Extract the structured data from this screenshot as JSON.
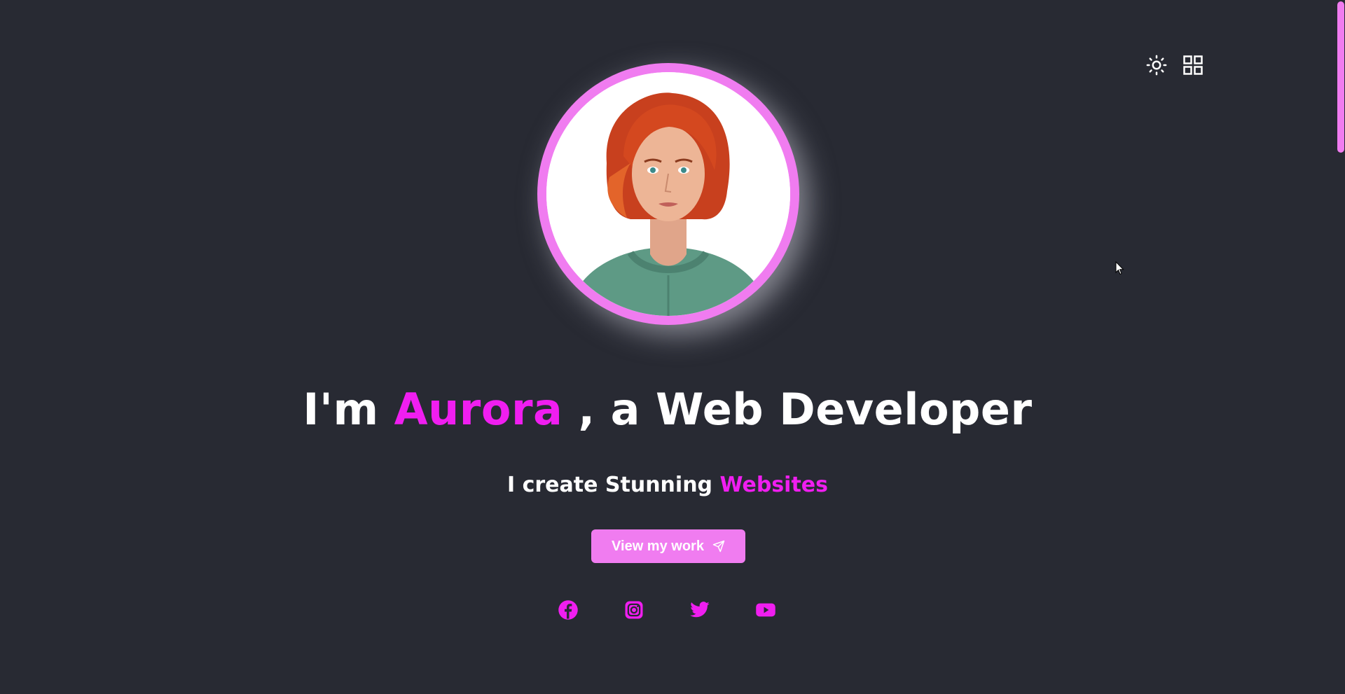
{
  "toolbar": {
    "theme_toggle_icon": "sun-icon",
    "menu_icon": "grid-icon"
  },
  "hero": {
    "heading_prefix": "I'm ",
    "heading_name": "Aurora",
    "heading_suffix": " , a Web Developer",
    "sub_prefix": "I create Stunning ",
    "sub_accent": "Websites",
    "cta_label": "View my work",
    "cta_icon": "send-icon"
  },
  "socials": [
    {
      "name": "facebook-icon"
    },
    {
      "name": "instagram-icon"
    },
    {
      "name": "twitter-icon"
    },
    {
      "name": "youtube-icon"
    }
  ],
  "colors": {
    "background": "#282a33",
    "accent": "#f01ef0",
    "accent_light": "#f07cf0",
    "text": "#ffffff"
  }
}
